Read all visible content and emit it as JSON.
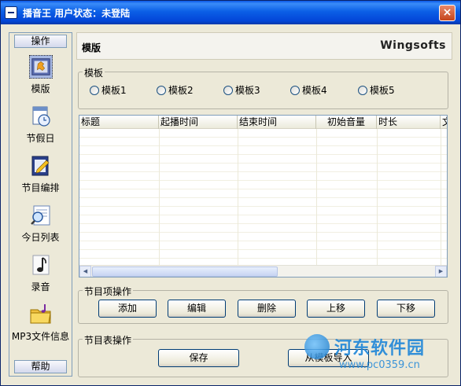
{
  "window": {
    "title": "播音王  用户状态：未登陆",
    "close_label": "×"
  },
  "sidebar": {
    "header": "操作",
    "footer": "帮助",
    "items": [
      {
        "label": "模版",
        "icon": "template-icon"
      },
      {
        "label": "节假日",
        "icon": "calendar-clock-icon"
      },
      {
        "label": "节目编排",
        "icon": "schedule-edit-icon"
      },
      {
        "label": "今日列表",
        "icon": "magnifier-list-icon"
      },
      {
        "label": "录音",
        "icon": "music-note-icon"
      },
      {
        "label": "MP3文件信息",
        "icon": "folder-music-icon"
      }
    ]
  },
  "banner": {
    "title": "模版",
    "brand": "Wingsofts"
  },
  "template_group": {
    "label": "模板",
    "options": [
      "模板1",
      "模板2",
      "模板3",
      "模板4",
      "模板5"
    ]
  },
  "table": {
    "columns": [
      "标题",
      "起播时间",
      "结束时间",
      "初始音量",
      "时长",
      "文"
    ]
  },
  "item_ops": {
    "label": "节目项操作",
    "buttons": [
      "添加",
      "编辑",
      "删除",
      "上移",
      "下移"
    ]
  },
  "table_ops": {
    "label": "节目表操作",
    "buttons": [
      "保存",
      "从模板导入"
    ]
  },
  "watermark": {
    "name": "河东软件园",
    "url": "www.pc0359.cn"
  },
  "colors": {
    "titlebar": "#0b5fe6",
    "accent": "#1d86d8"
  }
}
